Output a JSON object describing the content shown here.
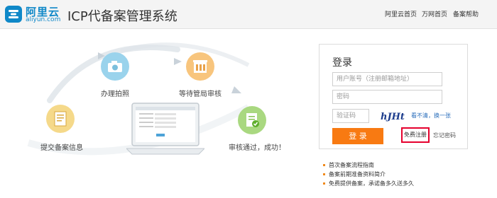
{
  "header": {
    "logo_brand": "阿里云",
    "logo_domain": "aliyun.com",
    "system_title": "ICP代备案管理系统",
    "nav": [
      "阿里云首页",
      "万网首页",
      "备案帮助"
    ]
  },
  "hero": {
    "steps": [
      {
        "label": "提交备案信息",
        "color": "#f5d98a",
        "icon": "document-icon"
      },
      {
        "label": "办理拍照",
        "color": "#9ad3ec",
        "icon": "camera-icon"
      },
      {
        "label": "等待管局审核",
        "color": "#f8c57d",
        "icon": "building-icon"
      },
      {
        "label": "审核通过，成功！",
        "color": "#a9d880",
        "icon": "approved-document-icon"
      }
    ]
  },
  "login": {
    "title": "登录",
    "account_placeholder": "用户账号（注册邮箱地址）",
    "password_placeholder": "密码",
    "captcha_placeholder": "验证码",
    "captcha_text": "hJHt",
    "refresh_text": "看不清，换一张",
    "login_button": "登 录",
    "register_link": "免费注册",
    "forgot_link": "忘记密码"
  },
  "links": [
    "首次备案流程指南",
    "备案前期准备资料简介",
    "免费提供备案，承诺备多久送多久"
  ],
  "colors": {
    "accent_orange": "#f87a12",
    "highlight_red": "#e5002d",
    "brand_blue": "#0f88c8"
  }
}
